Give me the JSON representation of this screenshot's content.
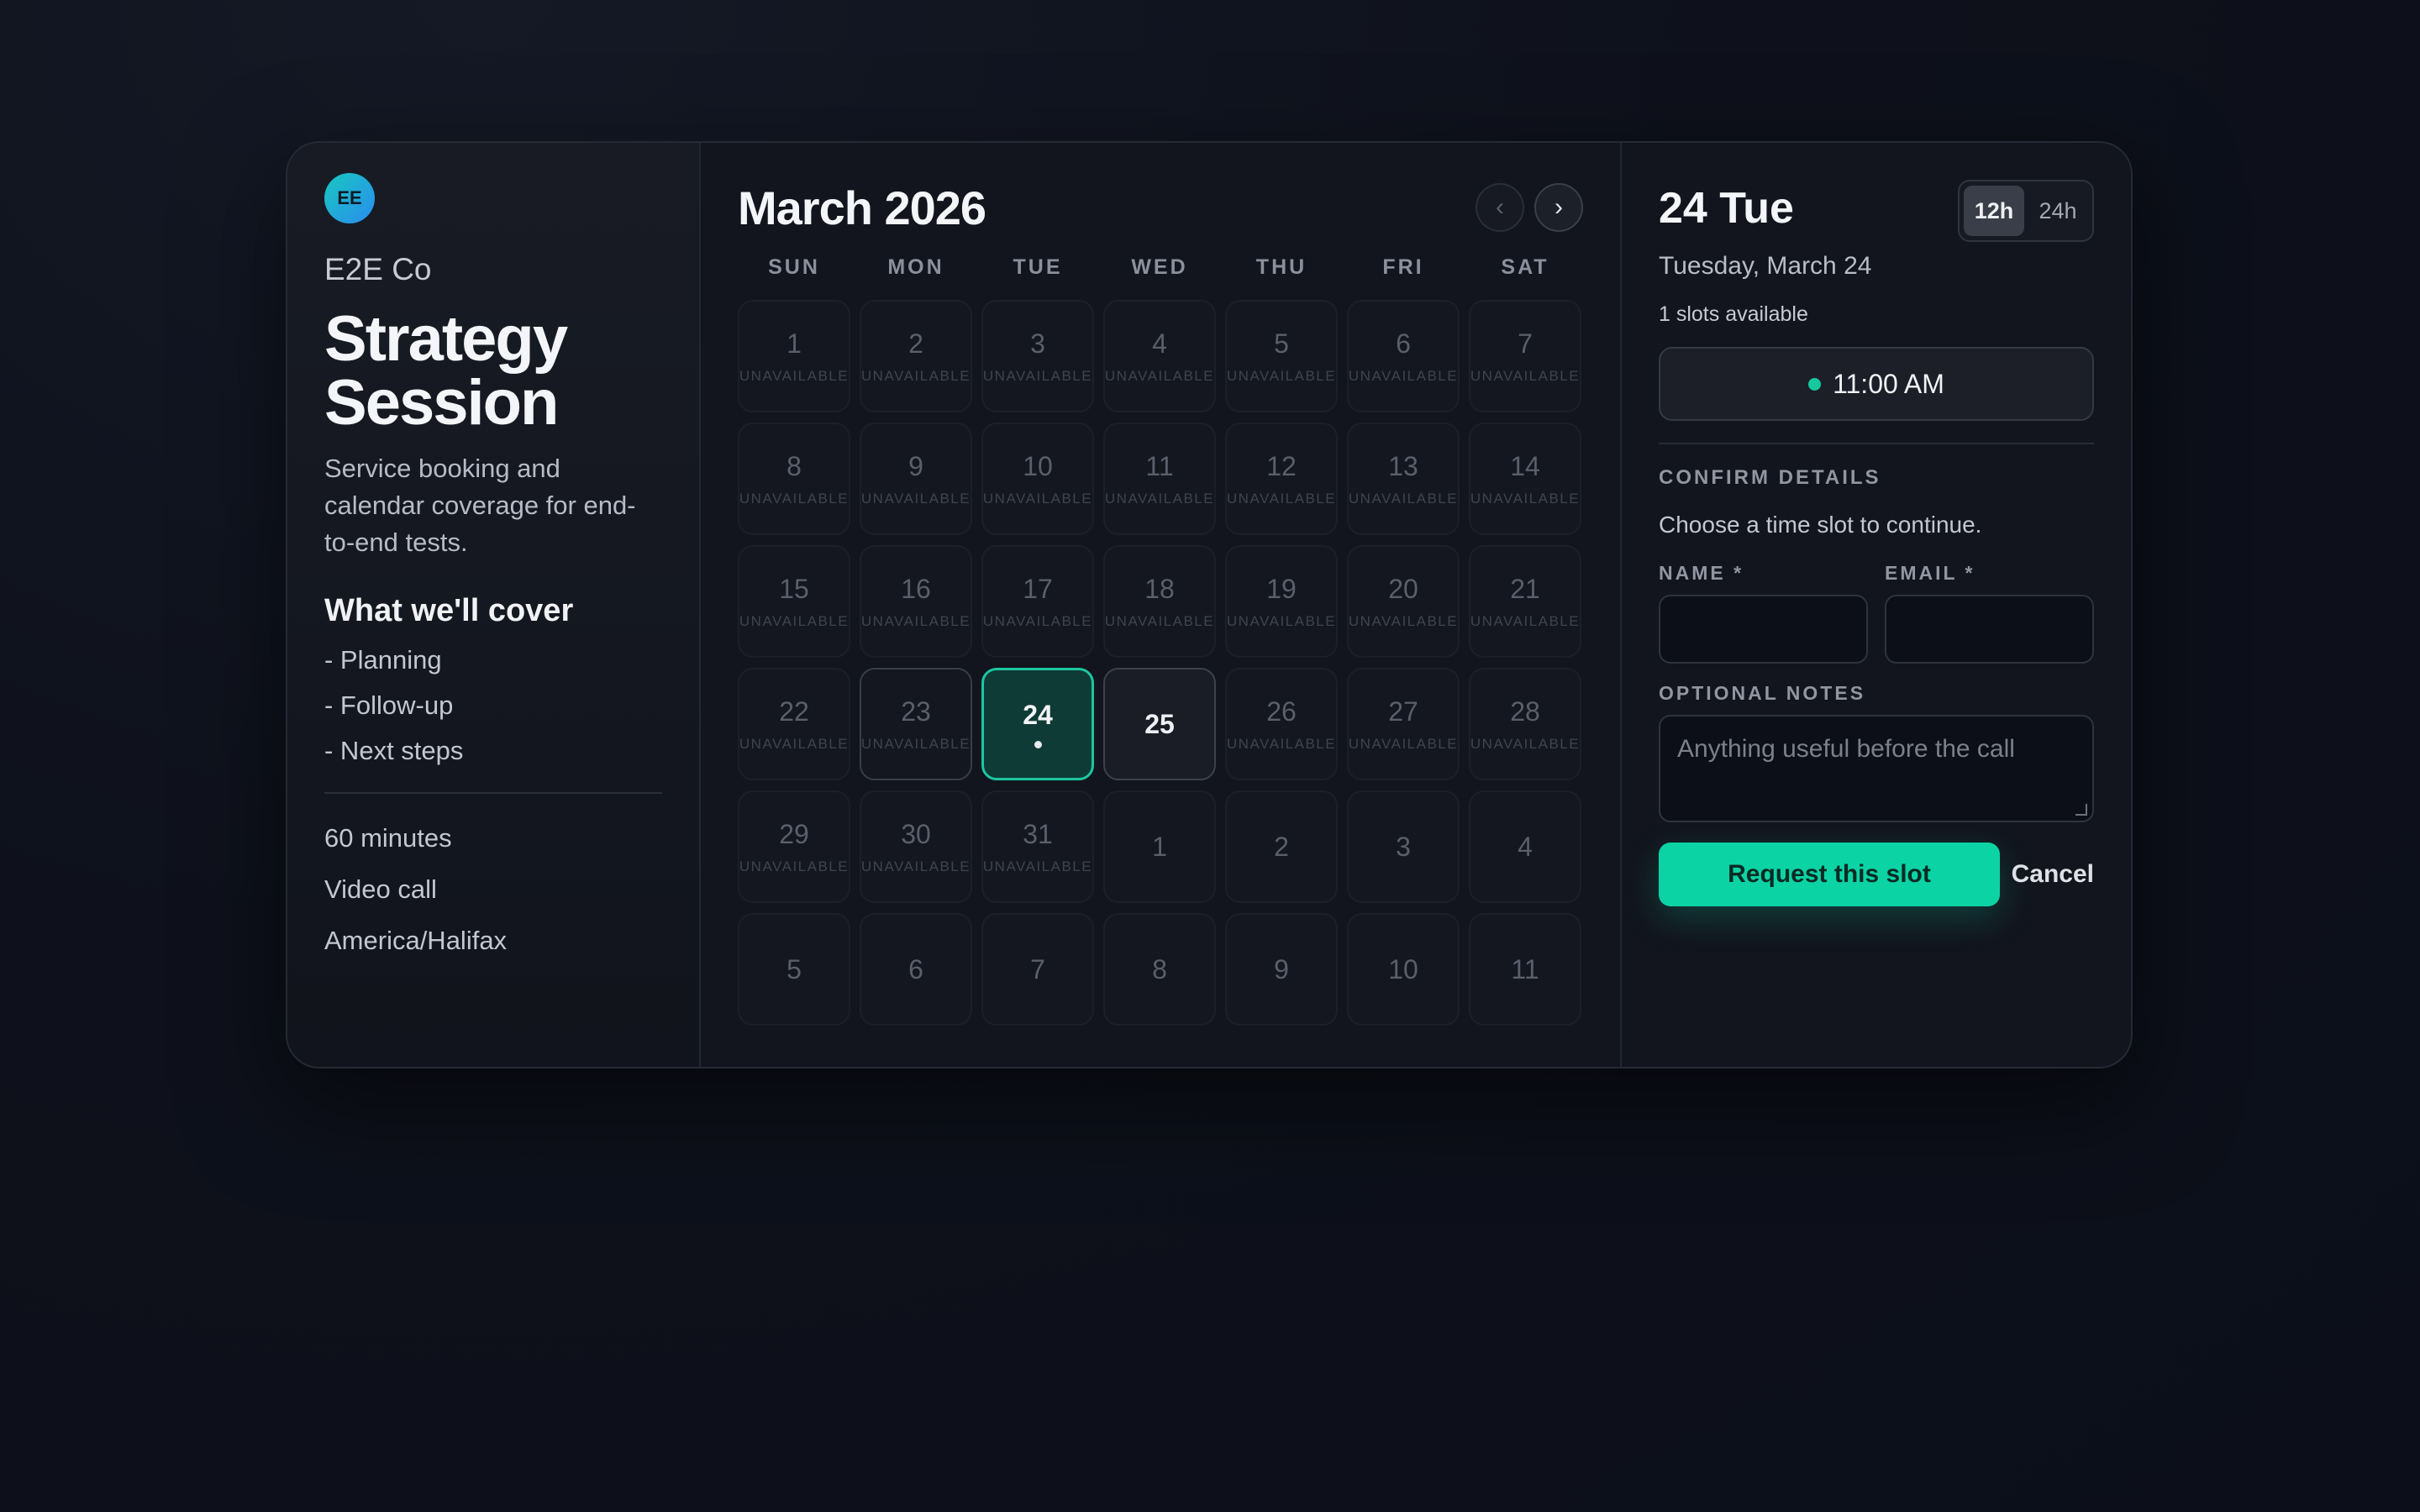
{
  "host": {
    "avatar_initials": "EE",
    "company": "E2E Co",
    "event_title_line1": "Strategy",
    "event_title_line2": "Session",
    "description": "Service booking and calendar coverage for end-to-end tests.",
    "cover_heading": "What we'll cover",
    "cover_items": [
      "- Planning",
      "- Follow-up",
      "- Next steps"
    ],
    "duration": "60 minutes",
    "location": "Video call",
    "timezone": "America/Halifax"
  },
  "calendar": {
    "month_label": "March 2026",
    "prev_icon": "‹",
    "next_icon": "›",
    "weekdays": [
      "SUN",
      "MON",
      "TUE",
      "WED",
      "THU",
      "FRI",
      "SAT"
    ],
    "unavailable_label": "UNAVAILABLE",
    "days": [
      {
        "n": "1",
        "s": "unavailable"
      },
      {
        "n": "2",
        "s": "unavailable"
      },
      {
        "n": "3",
        "s": "unavailable"
      },
      {
        "n": "4",
        "s": "unavailable"
      },
      {
        "n": "5",
        "s": "unavailable"
      },
      {
        "n": "6",
        "s": "unavailable"
      },
      {
        "n": "7",
        "s": "unavailable"
      },
      {
        "n": "8",
        "s": "unavailable"
      },
      {
        "n": "9",
        "s": "unavailable"
      },
      {
        "n": "10",
        "s": "unavailable"
      },
      {
        "n": "11",
        "s": "unavailable"
      },
      {
        "n": "12",
        "s": "unavailable"
      },
      {
        "n": "13",
        "s": "unavailable"
      },
      {
        "n": "14",
        "s": "unavailable"
      },
      {
        "n": "15",
        "s": "unavailable"
      },
      {
        "n": "16",
        "s": "unavailable"
      },
      {
        "n": "17",
        "s": "unavailable"
      },
      {
        "n": "18",
        "s": "unavailable"
      },
      {
        "n": "19",
        "s": "unavailable"
      },
      {
        "n": "20",
        "s": "unavailable"
      },
      {
        "n": "21",
        "s": "unavailable"
      },
      {
        "n": "22",
        "s": "unavailable"
      },
      {
        "n": "23",
        "s": "unavailable-today"
      },
      {
        "n": "24",
        "s": "selected"
      },
      {
        "n": "25",
        "s": "available"
      },
      {
        "n": "26",
        "s": "unavailable"
      },
      {
        "n": "27",
        "s": "unavailable"
      },
      {
        "n": "28",
        "s": "unavailable"
      },
      {
        "n": "29",
        "s": "unavailable"
      },
      {
        "n": "30",
        "s": "unavailable"
      },
      {
        "n": "31",
        "s": "unavailable"
      },
      {
        "n": "1",
        "s": "next-month"
      },
      {
        "n": "2",
        "s": "next-month"
      },
      {
        "n": "3",
        "s": "next-month"
      },
      {
        "n": "4",
        "s": "next-month"
      },
      {
        "n": "5",
        "s": "next-month"
      },
      {
        "n": "6",
        "s": "next-month"
      },
      {
        "n": "7",
        "s": "next-month"
      },
      {
        "n": "8",
        "s": "next-month"
      },
      {
        "n": "9",
        "s": "next-month"
      },
      {
        "n": "10",
        "s": "next-month"
      },
      {
        "n": "11",
        "s": "next-month"
      }
    ]
  },
  "slots": {
    "date_title": "24 Tue",
    "date_long": "Tuesday, March 24",
    "count_text": "1 slots available",
    "format_12h": "12h",
    "format_24h": "24h",
    "times": [
      "11:00 AM"
    ]
  },
  "form": {
    "section_heading": "CONFIRM DETAILS",
    "hint": "Choose a time slot to continue.",
    "name_label": "NAME *",
    "name_value": "",
    "email_label": "EMAIL *",
    "email_value": "",
    "notes_label": "OPTIONAL NOTES",
    "notes_placeholder": "Anything useful before the call",
    "submit_label": "Request this slot",
    "cancel_label": "Cancel"
  },
  "colors": {
    "accent": "#0cd3a4",
    "selected_day_bg": "#0f3b36",
    "background": "#0e111b"
  }
}
